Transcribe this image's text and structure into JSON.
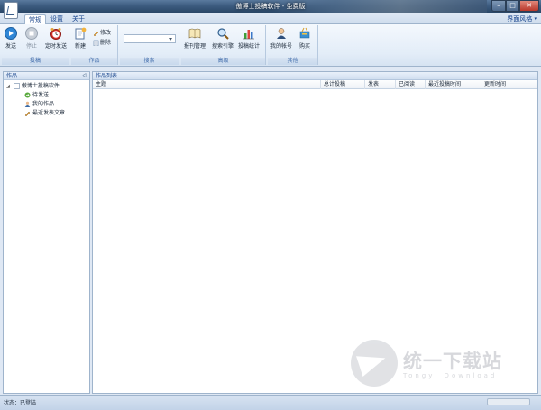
{
  "window": {
    "title": "傲博士投稿软件 - 免费版",
    "minimize": "–",
    "maximize": "□",
    "close": "✕"
  },
  "tabs": [
    {
      "label": "常规",
      "active": true
    },
    {
      "label": "设置",
      "active": false
    },
    {
      "label": "关于",
      "active": false
    }
  ],
  "skin_menu": "界面风格 ▾",
  "ribbon": {
    "groups": {
      "submit": {
        "label": "投稿",
        "send": "发送",
        "stop": "停止",
        "scheduled": "定时发送"
      },
      "works": {
        "label": "作品",
        "new": "新建",
        "edit": "修改",
        "delete": "删除"
      },
      "search": {
        "label": "搜索",
        "value": ""
      },
      "advanced": {
        "label": "高级",
        "periodical": "报刊管理",
        "search_engine": "搜索引擎",
        "stats": "投稿统计"
      },
      "other": {
        "label": "其他",
        "account": "我的帐号",
        "buy": "购买"
      }
    }
  },
  "left_panel": {
    "title": "作品",
    "pin": "ᐊ",
    "tree": {
      "root": {
        "expander": "◢",
        "label": "傲博士投稿软件"
      },
      "children": [
        {
          "label": "待发送",
          "icon": "pending-send-icon"
        },
        {
          "label": "我的作品",
          "icon": "my-works-icon"
        },
        {
          "label": "最近发表文章",
          "icon": "recent-articles-icon"
        }
      ]
    }
  },
  "right_panel": {
    "title": "作品列表",
    "columns": [
      "主题",
      "总计投稿",
      "发表",
      "已阅读",
      "最近投稿时间",
      "更新时间"
    ]
  },
  "status": {
    "text": "状态：已登陆"
  },
  "watermark": {
    "title": "统一下载站",
    "subtitle": "Tongyi Download"
  },
  "colors": {
    "accent": "#15428b",
    "ribbon_group_label": "#3e6aaa",
    "border": "#9fb4cc"
  }
}
